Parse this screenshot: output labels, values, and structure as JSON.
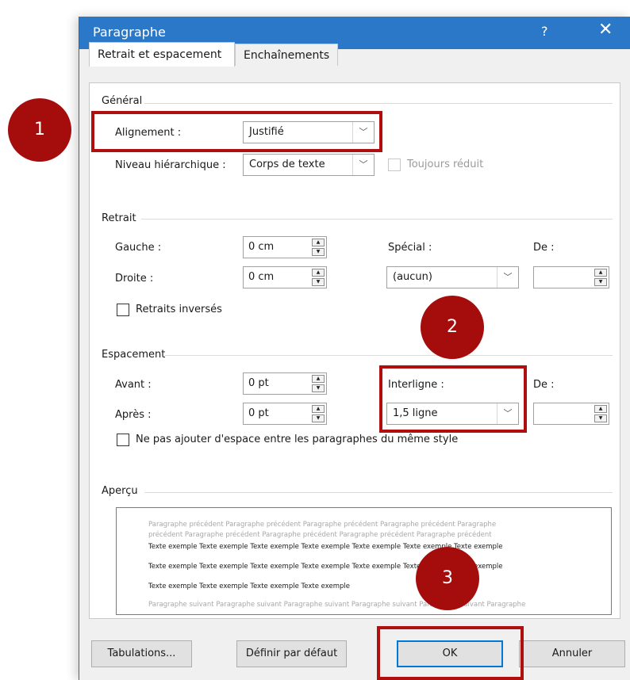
{
  "window": {
    "title": "Paragraphe",
    "help_glyph": "?",
    "close_glyph": "✕"
  },
  "tabs": [
    {
      "label": "Retrait et espacement",
      "active": true
    },
    {
      "label": "Enchaînements",
      "active": false
    }
  ],
  "general": {
    "section": "Général",
    "alignment_label": "Alignement :",
    "alignment_value": "Justifié",
    "level_label": "Niveau hiérarchique :",
    "level_value": "Corps de texte",
    "collapsed_label": "Toujours réduit"
  },
  "indent": {
    "section": "Retrait",
    "left_label": "Gauche :",
    "left_value": "0 cm",
    "right_label": "Droite :",
    "right_value": "0 cm",
    "special_label": "Spécial :",
    "special_value": "(aucun)",
    "by_label": "De :",
    "by_value": "",
    "mirror_label": "Retraits inversés"
  },
  "spacing": {
    "section": "Espacement",
    "before_label": "Avant :",
    "before_value": "0 pt",
    "after_label": "Après :",
    "after_value": "0 pt",
    "line_label": "Interligne :",
    "line_value": "1,5 ligne",
    "at_label": "De :",
    "at_value": "",
    "no_space_label": "Ne pas ajouter d'espace entre les paragraphes du même style"
  },
  "preview": {
    "section": "Aperçu",
    "prev_line1": "Paragraphe précédent Paragraphe précédent Paragraphe précédent Paragraphe précédent Paragraphe",
    "prev_line2": "précédent Paragraphe précédent Paragraphe précédent Paragraphe précédent Paragraphe précédent",
    "sample_line1": "Texte exemple Texte exemple Texte exemple Texte exemple Texte exemple Texte exemple Texte exemple",
    "sample_line2": "Texte exemple Texte exemple Texte exemple Texte exemple Texte exemple Texte exemple Texte exemple",
    "sample_line3": "Texte exemple Texte exemple Texte exemple Texte exemple",
    "next_line1": "Paragraphe suivant Paragraphe suivant Paragraphe suivant Paragraphe suivant Paragraphe suivant Paragraphe"
  },
  "buttons": {
    "tabs": "Tabulations...",
    "default": "Définir par défaut",
    "ok": "OK",
    "cancel": "Annuler"
  },
  "badges": [
    "1",
    "2",
    "3"
  ],
  "colors": {
    "titlebar": "#2b78c8",
    "highlight": "#b00f0f",
    "badge": "#a50d0d",
    "ok_border": "#0078d7"
  }
}
